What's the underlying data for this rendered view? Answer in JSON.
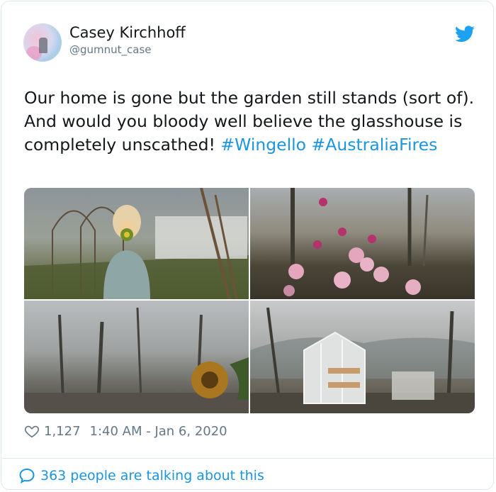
{
  "author": {
    "name": "Casey Kirchhoff",
    "handle": "@gumnut_case",
    "avatar_icon": "profile-avatar"
  },
  "brand": {
    "icon": "twitter-bird-icon",
    "color": "#1da1f2"
  },
  "tweet": {
    "text_before": "Our home is gone but the garden still stands (sort of). And would you bloody well believe the glasshouse is completely unscathed! ",
    "hashtags": [
      "#Wingello",
      "#AustraliaFires"
    ],
    "hashtag_color": "#1b95e0"
  },
  "media": [
    {
      "icon": "photo-woman-gas-mask-garden"
    },
    {
      "icon": "photo-pink-globe-amaranth-flowers"
    },
    {
      "icon": "photo-burnt-forest-sunflower"
    },
    {
      "icon": "photo-glasshouse-burnt-garden"
    }
  ],
  "stats": {
    "likes": "1,127",
    "timestamp": "1:40 AM - Jan 6, 2020",
    "like_icon": "heart-outline-icon"
  },
  "footer": {
    "talking_text": "363 people are talking about this",
    "icon": "speech-bubble-icon"
  }
}
